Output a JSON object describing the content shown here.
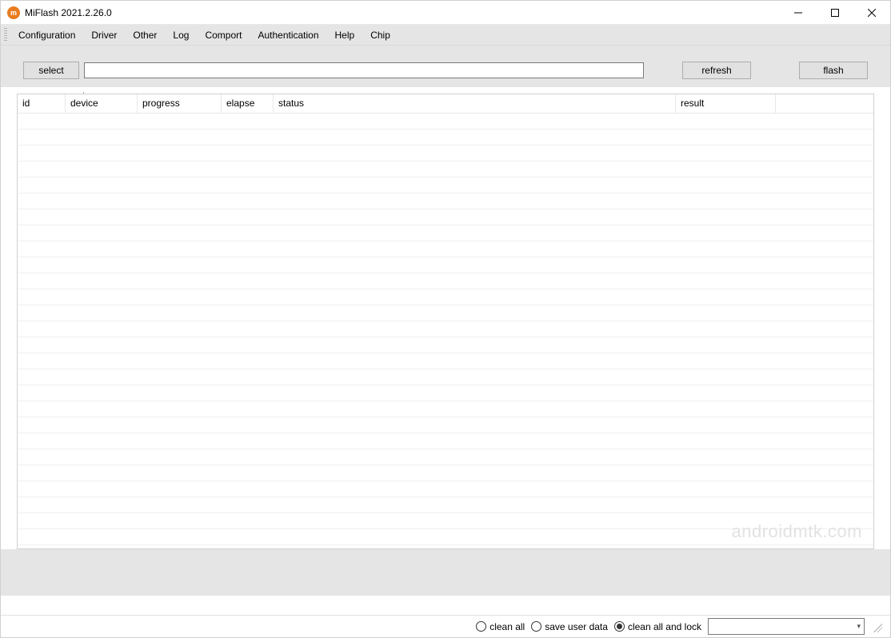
{
  "window": {
    "title": "MiFlash 2021.2.26.0",
    "icon_letter": "m"
  },
  "menu": {
    "items": [
      "Configuration",
      "Driver",
      "Other",
      "Log",
      "Comport",
      "Authentication",
      "Help",
      "Chip"
    ]
  },
  "toolbar": {
    "select_label": "select",
    "refresh_label": "refresh",
    "flash_label": "flash",
    "path_value": ""
  },
  "table": {
    "headers": {
      "id": "id",
      "device": "device",
      "progress": "progress",
      "elapse": "elapse",
      "status": "status",
      "result": "result"
    },
    "empty_row_count": 27
  },
  "statusbar": {
    "radios": {
      "clean_all": "clean all",
      "save_user_data": "save user data",
      "clean_all_and_lock": "clean all and lock"
    },
    "selected_radio": "clean_all_and_lock",
    "combo_value": ""
  },
  "watermark": "androidmtk.com"
}
